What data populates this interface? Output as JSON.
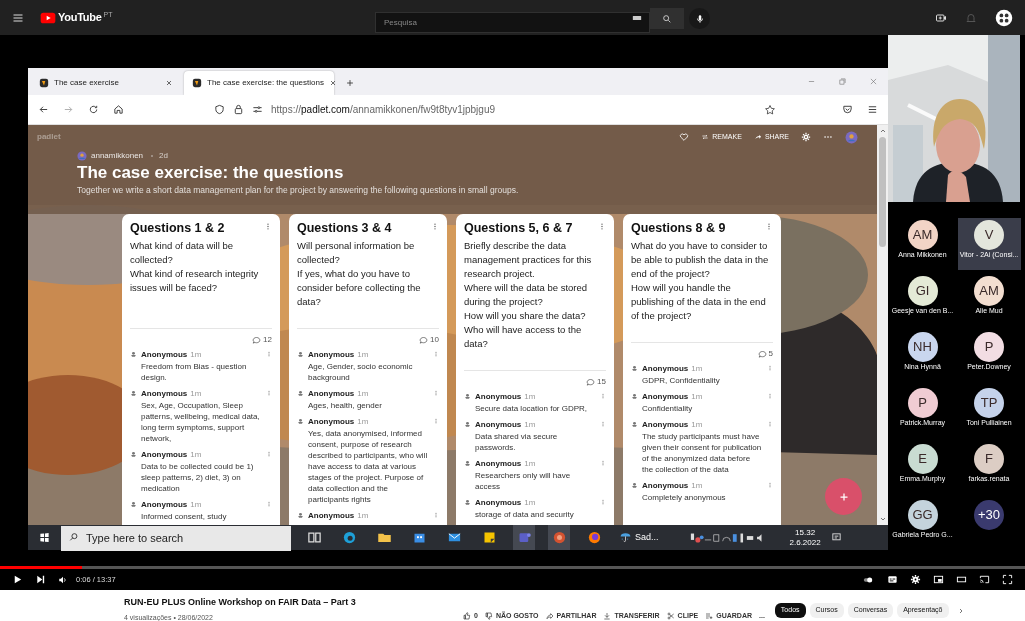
{
  "youtube": {
    "logo": "YouTube",
    "region": "PT",
    "search_placeholder": "Pesquisa"
  },
  "browser": {
    "tabs": [
      {
        "title": "The case exercise",
        "selected": false
      },
      {
        "title": "The case exercise: the questions",
        "selected": true
      }
    ],
    "url": {
      "scheme": "https://",
      "host": "padlet.com",
      "path": "/annamikkonen/fw9t8tyv1jpbjgu9"
    }
  },
  "padlet": {
    "brand": "padlet",
    "actions": [
      "REMAKE",
      "SHARE"
    ],
    "author": "annamikkonen",
    "age": "2d",
    "title": "The case exercise: the questions",
    "description": "Together we write a short data management plan for the project by answering the following questions in small groups.",
    "columns": [
      {
        "title": "Questions 1 & 2",
        "question": [
          "What kind of data will be collected?",
          "What kind of research integrity issues will be faced?"
        ],
        "comments": "12",
        "posts": [
          {
            "author": "Anonymous",
            "age": "1m",
            "text": "Freedom from Bias - question design."
          },
          {
            "author": "Anonymous",
            "age": "1m",
            "text": "Sex, Age, Occupation, Sleep patterns, wellbeing, medical data, long term symptoms, support network,"
          },
          {
            "author": "Anonymous",
            "age": "1m",
            "text": "Data to be collected could be 1) sleep patterns, 2) diet, 3) on medication"
          },
          {
            "author": "Anonymous",
            "age": "1m",
            "text": "Informed consent, study"
          }
        ]
      },
      {
        "title": "Questions 3 & 4",
        "question": [
          "Will personal information be collected?",
          "If yes, what do you have to consider before collecting the data?"
        ],
        "comments": "10",
        "posts": [
          {
            "author": "Anonymous",
            "age": "1m",
            "text": "Age, Gender, socio economic background"
          },
          {
            "author": "Anonymous",
            "age": "1m",
            "text": "Ages, health, gender"
          },
          {
            "author": "Anonymous",
            "age": "1m",
            "text": "Yes, data anonymised, informed consent, purpose of research described to participants, who will have access to data at various stages of the project. Purpose of data collection and the participants rights"
          },
          {
            "author": "Anonymous",
            "age": "1m"
          }
        ]
      },
      {
        "title": "Questions 5, 6 & 7",
        "question": [
          "Briefly describe the data management practices for this research project.",
          "Where will the data be stored during the project?",
          "How will you share the data?",
          "Who will have access to the data?"
        ],
        "comments": "15",
        "posts": [
          {
            "author": "Anonymous",
            "age": "1m",
            "text": "Secure data location for GDPR,"
          },
          {
            "author": "Anonymous",
            "age": "1m",
            "text": "Data shared via secure passwords."
          },
          {
            "author": "Anonymous",
            "age": "1m",
            "text": "Researchers only will have access"
          },
          {
            "author": "Anonymous",
            "age": "1m",
            "text": "storage of data and security"
          }
        ]
      },
      {
        "title": "Questions 8 & 9",
        "question": [
          "What do you have to consider to be able to publish the data in the end of the project?",
          "How will you handle the publishing of the data in the end of the project?"
        ],
        "comments": "5",
        "posts": [
          {
            "author": "Anonymous",
            "age": "1m",
            "text": "GDPR, Confidentiality"
          },
          {
            "author": "Anonymous",
            "age": "1m",
            "text": "Confidentiality"
          },
          {
            "author": "Anonymous",
            "age": "1m",
            "text": "The study participants must have given their consent for publication of the anonymized data before the collection of the data"
          },
          {
            "author": "Anonymous",
            "age": "1m",
            "text": "Completely anonymous"
          }
        ]
      }
    ]
  },
  "taskbar": {
    "search_placeholder": "Type here to search",
    "weather": "Sad...",
    "time": "15.32",
    "date": "2.6.2022"
  },
  "participants": [
    {
      "initials": "AM",
      "name": "Anna Mikkonen",
      "color": "#f2d4c6",
      "selected": false
    },
    {
      "initials": "V",
      "name": "Vitor - 2Ai (Consi...",
      "color": "#e3e6dc",
      "selected": true
    },
    {
      "initials": "GI",
      "name": "Geesje van den B...",
      "color": "#e4ead6",
      "selected": false
    },
    {
      "initials": "AM",
      "name": "Alie Mud",
      "color": "#f3ded0",
      "selected": false
    },
    {
      "initials": "NH",
      "name": "Nina Hynnä",
      "color": "#c9d6ee",
      "selected": false
    },
    {
      "initials": "P",
      "name": "Peter.Downey",
      "color": "#f2dde3",
      "selected": false
    },
    {
      "initials": "P",
      "name": "Patrick.Murray",
      "color": "#f0ccd3",
      "selected": false
    },
    {
      "initials": "TP",
      "name": "Toni Pulliainen",
      "color": "#c5d2ea",
      "selected": false
    },
    {
      "initials": "E",
      "name": "Emma.Murphy",
      "color": "#c9dcd2",
      "selected": false
    },
    {
      "initials": "F",
      "name": "farkas.renata",
      "color": "#dccdc4",
      "selected": false
    },
    {
      "initials": "GG",
      "name": "Gabriela Pedro G...",
      "color": "#c4d3dc",
      "selected": false
    },
    {
      "initials": "+30",
      "color": "#3a3a6e",
      "selected": false
    }
  ],
  "player": {
    "level": 0.08,
    "time": "0:06 / 13:37"
  },
  "video": {
    "title": "RUN-EU PLUS Online Workshop on FAIR Data – Part 3",
    "meta": "4 visualizações • 28/06/2022",
    "likes": "0",
    "actions": [
      "NÃO GOSTO",
      "PARTILHAR",
      "TRANSFERIR",
      "CLIPE",
      "GUARDAR"
    ],
    "more": "...",
    "chips": [
      {
        "label": "Todos",
        "selected": true
      },
      {
        "label": "Cursos",
        "selected": false
      },
      {
        "label": "Conversas",
        "selected": false
      },
      {
        "label": "Apresentaçõ",
        "selected": false
      }
    ]
  }
}
